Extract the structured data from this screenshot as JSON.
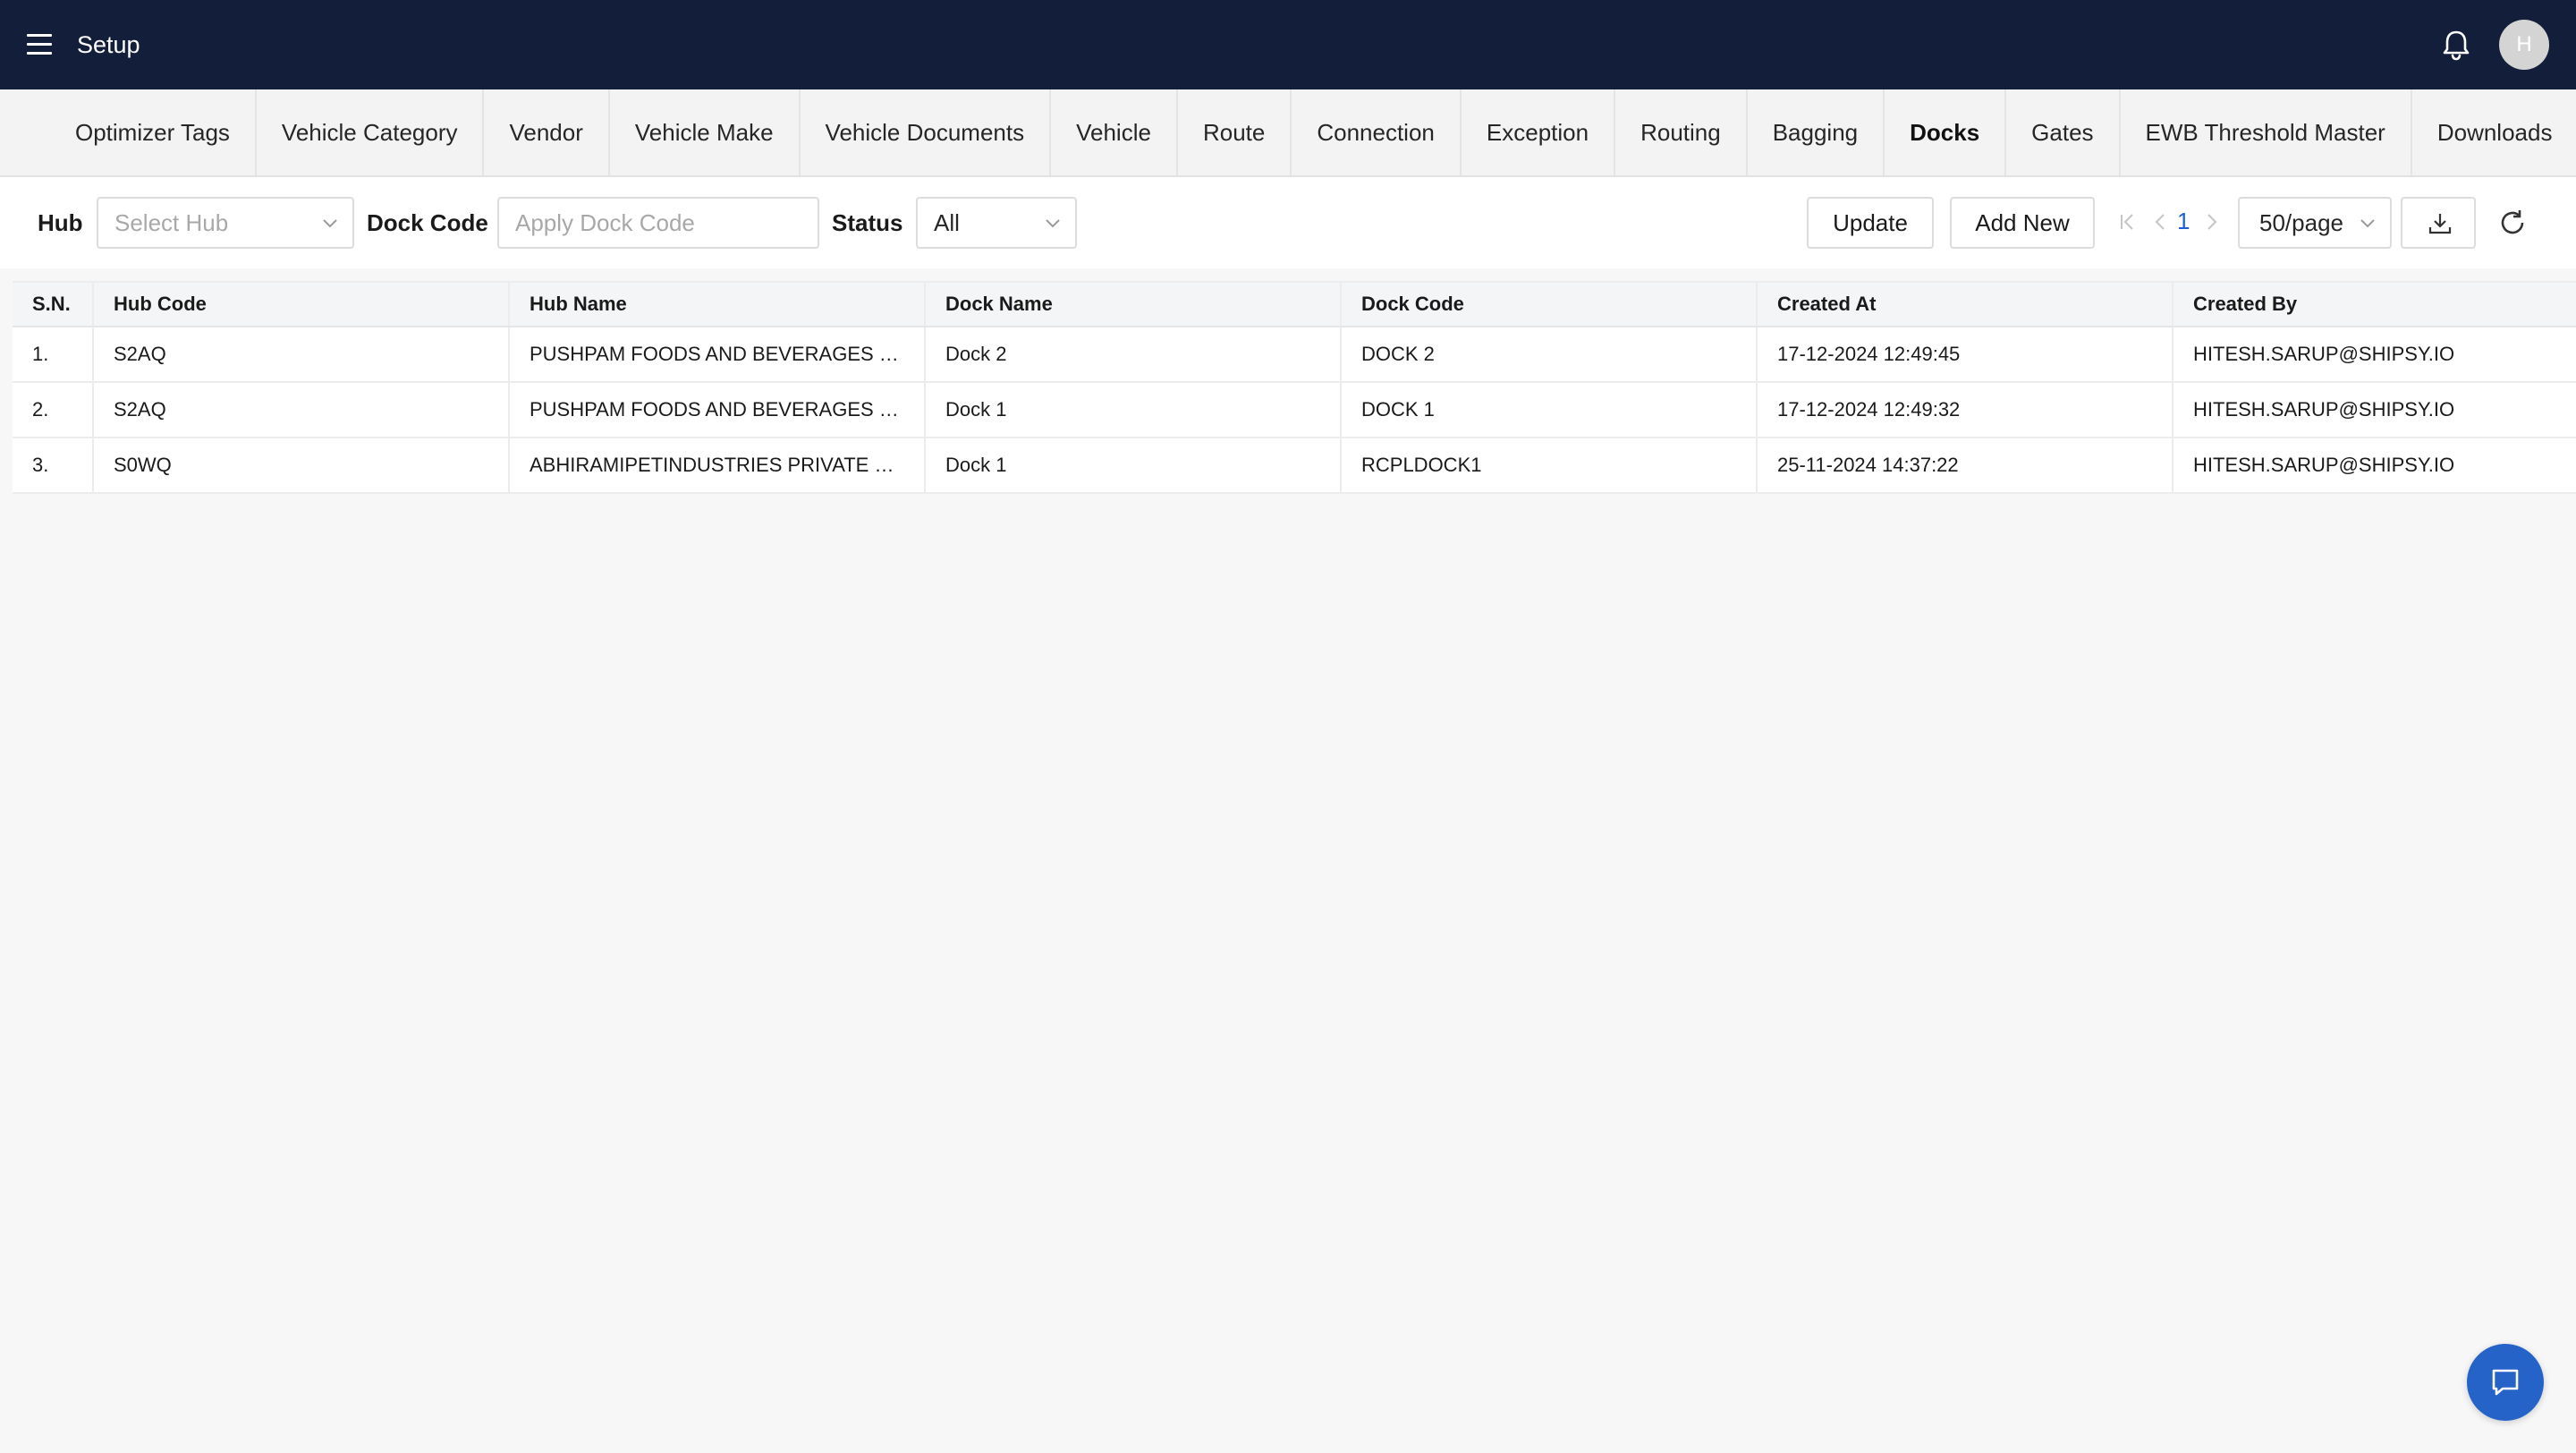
{
  "header": {
    "title": "Setup",
    "avatar_initial": "H"
  },
  "tabs": [
    {
      "label": "Optimizer Tags"
    },
    {
      "label": "Vehicle Category"
    },
    {
      "label": "Vendor"
    },
    {
      "label": "Vehicle Make"
    },
    {
      "label": "Vehicle Documents"
    },
    {
      "label": "Vehicle"
    },
    {
      "label": "Route"
    },
    {
      "label": "Connection"
    },
    {
      "label": "Exception"
    },
    {
      "label": "Routing"
    },
    {
      "label": "Bagging"
    },
    {
      "label": "Docks",
      "active": true
    },
    {
      "label": "Gates"
    },
    {
      "label": "EWB Threshold Master"
    },
    {
      "label": "Downloads"
    }
  ],
  "filters": {
    "hub_label": "Hub",
    "hub_placeholder": "Select Hub",
    "dock_code_label": "Dock Code",
    "dock_code_placeholder": "Apply Dock Code",
    "status_label": "Status",
    "status_value": "All"
  },
  "actions": {
    "update_label": "Update",
    "add_new_label": "Add New",
    "current_page": "1",
    "page_size": "50/page"
  },
  "table": {
    "columns": [
      "S.N.",
      "Hub Code",
      "Hub Name",
      "Dock Name",
      "Dock Code",
      "Created At",
      "Created By"
    ],
    "rows": [
      [
        "1.",
        "S2AQ",
        "PUSHPAM FOODS AND BEVERAGES P...",
        "Dock 2",
        "DOCK 2",
        "17-12-2024 12:49:45",
        "HITESH.SARUP@SHIPSY.IO"
      ],
      [
        "2.",
        "S2AQ",
        "PUSHPAM FOODS AND BEVERAGES P...",
        "Dock 1",
        "DOCK 1",
        "17-12-2024 12:49:32",
        "HITESH.SARUP@SHIPSY.IO"
      ],
      [
        "3.",
        "S0WQ",
        "ABHIRAMIPETINDUSTRIES PRIVATE LI...",
        "Dock 1",
        "RCPLDOCK1",
        "25-11-2024 14:37:22",
        "HITESH.SARUP@SHIPSY.IO"
      ]
    ]
  },
  "icons": {
    "menu": "menu-icon",
    "bell": "bell-icon",
    "download": "download-icon",
    "refresh": "refresh-icon",
    "chat": "chat-icon"
  },
  "colors": {
    "header_bg": "#131f3a",
    "accent": "#1d5fd6",
    "chat_bg": "#2563c9"
  }
}
